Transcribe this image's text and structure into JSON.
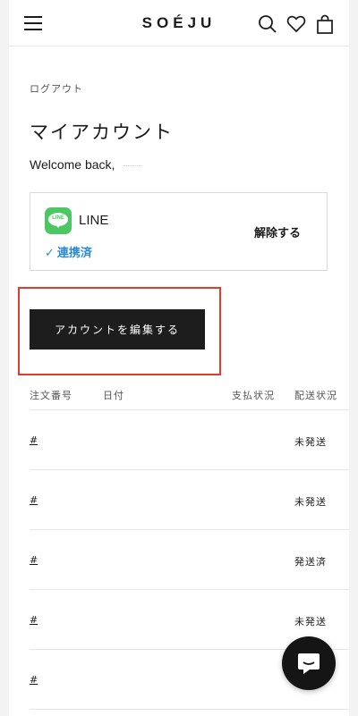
{
  "header": {
    "brand": "SOÉJU",
    "icons": [
      "menu-icon",
      "search-icon",
      "heart-icon",
      "bag-icon"
    ]
  },
  "account": {
    "logout_label": "ログアウト",
    "title": "マイアカウント",
    "welcome": "Welcome back,"
  },
  "line": {
    "logo_text": "LINE",
    "name": "LINE",
    "status": "連携済",
    "unlink_label": "解除する",
    "status_color": "#2d8ad1",
    "brand_color": "#4cc764"
  },
  "edit_button": {
    "label": "アカウントを編集する",
    "highlight_color": "#e03b2b"
  },
  "orders": {
    "columns": [
      "注文番号",
      "日付",
      "支払状況",
      "配送状況"
    ],
    "rows": [
      {
        "order_no": "#",
        "ship_status": "未発送"
      },
      {
        "order_no": "#",
        "ship_status": "未発送"
      },
      {
        "order_no": "#",
        "ship_status": "発送済"
      },
      {
        "order_no": "#",
        "ship_status": "未発送"
      },
      {
        "order_no": "#",
        "ship_status": ""
      }
    ]
  }
}
